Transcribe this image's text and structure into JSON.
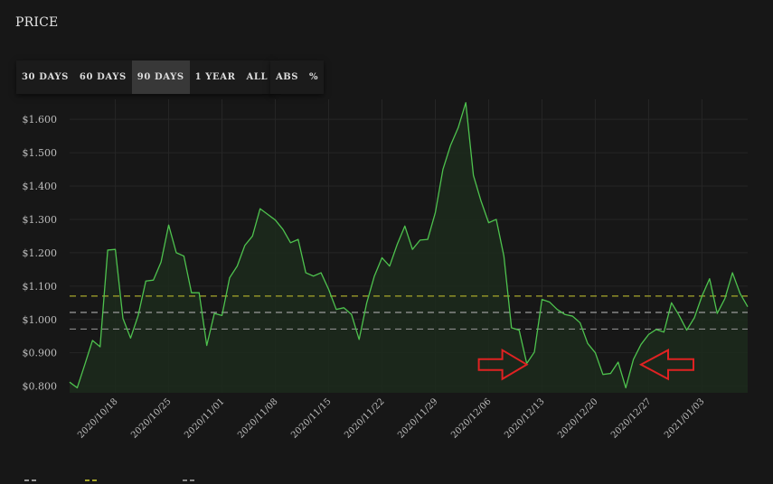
{
  "page": {
    "title": "PRICE"
  },
  "toolbar": {
    "ranges": [
      {
        "label": "30 DAYS",
        "active": false
      },
      {
        "label": "60 DAYS",
        "active": false
      },
      {
        "label": "90 DAYS",
        "active": true
      },
      {
        "label": "1 YEAR",
        "active": false
      },
      {
        "label": "ALL",
        "active": false
      }
    ],
    "modes": [
      {
        "label": "ABS"
      },
      {
        "label": "%"
      }
    ]
  },
  "colors": {
    "line": "#4ec24e",
    "fill": "#1c2a1c",
    "grid": "#262626",
    "mean_line": "#9b9b9b",
    "upper_band": "#a7a72b",
    "lower_band": "#8a8a8a",
    "axis_text": "#bdbdbd",
    "annotation_arrow": "#e02222"
  },
  "chart_data": {
    "type": "area",
    "ylim": [
      0.78,
      1.66
    ],
    "y_ticks": [
      "$0.800",
      "$0.900",
      "$1.000",
      "$1.100",
      "$1.200",
      "$1.300",
      "$1.400",
      "$1.500",
      "$1.600"
    ],
    "y_tick_values": [
      0.8,
      0.9,
      1.0,
      1.1,
      1.2,
      1.3,
      1.4,
      1.5,
      1.6
    ],
    "x_ticks": [
      "2020/10/18",
      "2020/10/25",
      "2020/11/01",
      "2020/11/08",
      "2020/11/15",
      "2020/11/22",
      "2020/11/29",
      "2020/12/06",
      "2020/12/13",
      "2020/12/20",
      "2020/12/27",
      "2021/01/03"
    ],
    "x_tick_index": [
      6,
      13,
      20,
      27,
      34,
      41,
      48,
      55,
      62,
      69,
      76,
      83
    ],
    "x_first_date": "2020/10/12",
    "grid": true,
    "series": [
      {
        "values": [
          0.812,
          0.795,
          0.865,
          0.937,
          0.918,
          1.208,
          1.21,
          1.003,
          0.944,
          1.012,
          1.115,
          1.118,
          1.172,
          1.283,
          1.2,
          1.19,
          1.08,
          1.08,
          0.922,
          1.018,
          1.012,
          1.125,
          1.16,
          1.222,
          1.25,
          1.332,
          1.315,
          1.298,
          1.27,
          1.23,
          1.24,
          1.14,
          1.13,
          1.14,
          1.09,
          1.03,
          1.035,
          1.015,
          0.94,
          1.05,
          1.13,
          1.185,
          1.16,
          1.225,
          1.28,
          1.21,
          1.238,
          1.24,
          1.32,
          1.45,
          1.522,
          1.575,
          1.65,
          1.432,
          1.355,
          1.29,
          1.3,
          1.19,
          0.975,
          0.968,
          0.868,
          0.902,
          1.06,
          1.052,
          1.03,
          1.015,
          1.01,
          0.99,
          0.928,
          0.9,
          0.835,
          0.838,
          0.872,
          0.795,
          0.88,
          0.925,
          0.955,
          0.97,
          0.962,
          1.05,
          1.012,
          0.968,
          1.005,
          1.07,
          1.122,
          1.018,
          1.062,
          1.14,
          1.078,
          1.038
        ]
      }
    ],
    "reference_lines": [
      {
        "role": "upper",
        "value": 1.07
      },
      {
        "role": "mean",
        "value": 1.021
      },
      {
        "role": "lower",
        "value": 0.971
      }
    ]
  },
  "annotations": [
    {
      "shape": "right-arrow",
      "at_index": 60,
      "at_value": 0.862
    },
    {
      "shape": "left-arrow",
      "at_index": 75,
      "at_value": 0.862
    }
  ]
}
